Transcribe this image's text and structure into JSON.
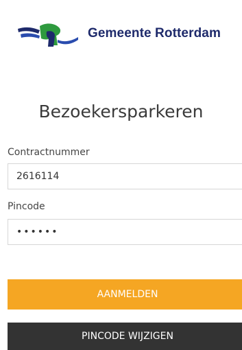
{
  "header": {
    "brand_name": "Gemeente Rotterdam",
    "logo_icon": "rotterdam-lion-flag-logo",
    "colors": {
      "brand_navy": "#1e2a6b",
      "brand_green": "#2e9a3e",
      "brand_blue": "#2a4cae"
    }
  },
  "main": {
    "title": "Bezoekersparkeren",
    "contract": {
      "label": "Contractnummer",
      "value": "2616114"
    },
    "pincode": {
      "label": "Pincode",
      "value": "••••••"
    },
    "login_button": {
      "label": "AANMELDEN",
      "color": "#f5a623"
    },
    "change_pin_button": {
      "label": "PINCODE WIJZIGEN",
      "color": "#333333"
    }
  }
}
